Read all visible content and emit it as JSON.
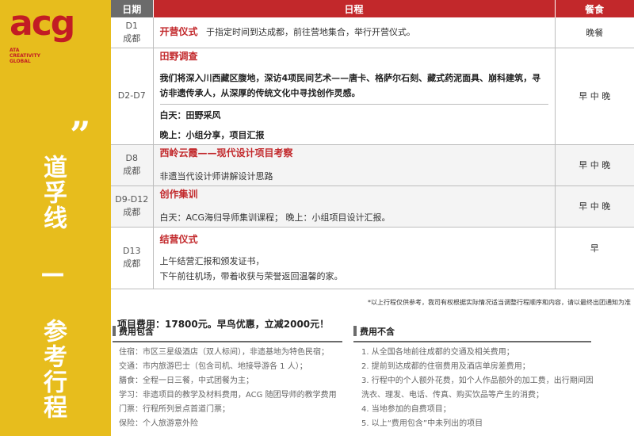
{
  "brand": {
    "logo_text": "acg",
    "logo_sub": [
      "ATA",
      "CREATIVITY",
      "GLOBAL"
    ]
  },
  "sidebar": {
    "quote_mark": "”",
    "title": "道孚线 — 参考行程"
  },
  "table": {
    "headers": {
      "date": "日期",
      "program": "日程",
      "meals": "餐食"
    },
    "rows": [
      {
        "date": "D1",
        "place": "成都",
        "title": "开营仪式",
        "lines": [
          "于指定时间到达成都，前往营地集合，举行开营仪式。"
        ],
        "meals": "晚餐"
      },
      {
        "date": "D2-D7",
        "place": "",
        "title": "田野调查",
        "lines": [
          "我们将深入川西藏区腹地，深访4项民间艺术——唐卡、格萨尔石刻、藏式药泥面具、崩科建筑，寻访非遗传承人，从深厚的传统文化中寻找创作灵感。",
          "白天：田野采风",
          "晚上：小组分享，项目汇报"
        ],
        "meals": "早 中 晚"
      },
      {
        "date": "D8",
        "place": "成都",
        "title": "西岭云霞——现代设计项目考察",
        "lines": [
          "非遗当代设计师讲解设计思路"
        ],
        "meals": "早 中 晚"
      },
      {
        "date": "D9-D12",
        "place": "成都",
        "title": "创作集训",
        "lines": [
          "白天：ACG海归导师集训课程； 晚上：小组项目设计汇报。"
        ],
        "meals": "早 中 晚"
      },
      {
        "date": "D13",
        "place": "成都",
        "title": "结营仪式",
        "lines": [
          "上午结营汇报和颁发证书，",
          "下午前往机场，带着收获与荣誉返回温馨的家。"
        ],
        "meals": "早"
      }
    ]
  },
  "note": "*以上行程仅供参考，我司有权根据实际情况适当调整行程顺序和内容，请以最终出团通知为准",
  "price": "项目费用：17800元。早鸟优惠，立减2000元！",
  "included": {
    "title": "费用包含",
    "items": [
      "住宿：市区三星级酒店（双人标间），非遗基地为特色民宿；",
      "交通：市内旅游巴士（包含司机、地接导游各 1 人）；",
      "膳食：全程一日三餐，中式团餐为主；",
      "学习：非遗项目的教学及材料费用，ACG 随团导师的教学费用",
      "门票：行程所列景点首道门票；",
      "保险：个人旅游意外险"
    ]
  },
  "excluded": {
    "title": "费用不含",
    "items": [
      "1. 从全国各地前往成都的交通及相关费用；",
      "2. 提前到达成都的住宿费用及酒店单房差费用；",
      "3. 行程中的个人额外花费，如个人作品额外的加工费，出行期间因洗衣、理发、电话、传真、购买饮品等产生的消费；",
      "4. 当地参加的自费项目；",
      "5. 以上“费用包含”中未列出的项目"
    ]
  },
  "colors": {
    "sidebar": "#e7bd1d",
    "accent": "#c2282b",
    "header_gray": "#6b6b6b"
  }
}
